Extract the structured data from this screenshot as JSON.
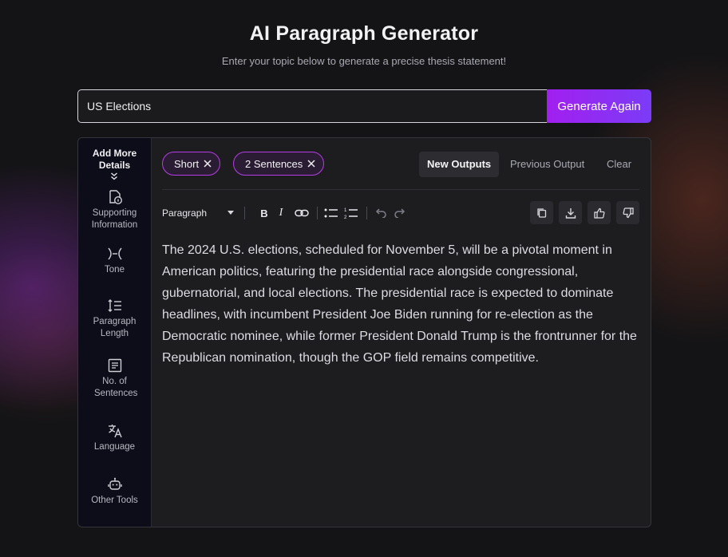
{
  "header": {
    "title": "AI Paragraph Generator",
    "subtitle": "Enter your topic below to generate a precise thesis statement!"
  },
  "search": {
    "value": "US Elections",
    "button_label": "Generate Again"
  },
  "sidebar": {
    "heading": "Add More Details",
    "items": [
      {
        "label": "Supporting Information",
        "icon": "supporting-info-icon"
      },
      {
        "label": "Tone",
        "icon": "tone-icon"
      },
      {
        "label": "Paragraph Length",
        "icon": "paragraph-length-icon"
      },
      {
        "label": "No. of Sentences",
        "icon": "sentences-icon"
      },
      {
        "label": "Language",
        "icon": "language-icon"
      },
      {
        "label": "Other Tools",
        "icon": "other-tools-icon"
      }
    ]
  },
  "chips": [
    {
      "label": "Short"
    },
    {
      "label": "2 Sentences"
    }
  ],
  "tabs": [
    {
      "label": "New Outputs",
      "active": true
    },
    {
      "label": "Previous Output",
      "active": false
    },
    {
      "label": "Clear",
      "active": false
    }
  ],
  "toolbar": {
    "format_select": "Paragraph"
  },
  "output": {
    "text": "The 2024 U.S. elections, scheduled for November 5, will be a pivotal moment in American politics, featuring the presidential race alongside congressional, gubernatorial, and local elections. The presidential race is expected to dominate headlines, with incumbent President Joe Biden running for re-election as the Democratic nominee, while former President Donald Trump is the frontrunner for the Republican nomination, though the GOP field remains competitive."
  },
  "colors": {
    "accent": "#a21ff0",
    "background": "#141416",
    "panel": "#1d1d20",
    "sidebar": "#0d0d1a"
  }
}
